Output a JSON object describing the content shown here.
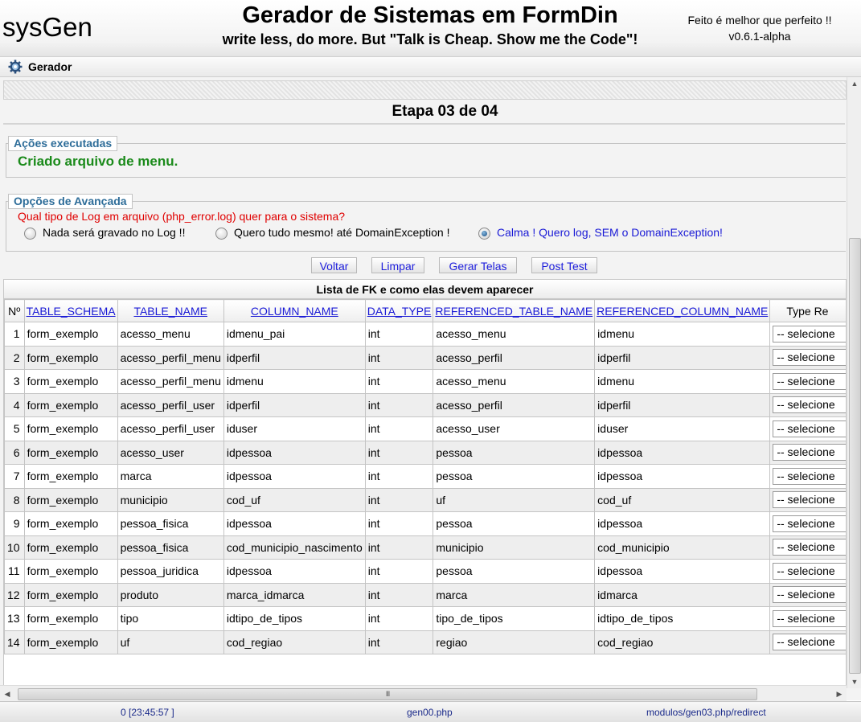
{
  "header": {
    "app_name": "sysGen",
    "title": "Gerador de Sistemas em FormDin",
    "subtitle": "write less, do more. But \"Talk is Cheap. Show me the Code\"!",
    "motto": "Feito é melhor que perfeito !!",
    "version": "v0.6.1-alpha"
  },
  "menu": {
    "icon": "gear-icon",
    "label": "Gerador"
  },
  "step": {
    "title": "Etapa 03 de 04"
  },
  "actions": {
    "legend": "Ações executadas",
    "message": "Criado arquivo de menu."
  },
  "options": {
    "legend": "Opções de Avançada",
    "question": "Qual tipo de Log em arquivo (php_error.log) quer para o sistema?",
    "radios": [
      {
        "label": "Nada será gravado no Log !!",
        "checked": false
      },
      {
        "label": "Quero tudo mesmo! até DomainException !",
        "checked": false
      },
      {
        "label": "Calma ! Quero log, SEM o DomainException!",
        "checked": true
      }
    ]
  },
  "buttons": {
    "back": "Voltar",
    "clear": "Limpar",
    "generate": "Gerar Telas",
    "post_test": "Post Test"
  },
  "grid": {
    "caption": "Lista de FK e como elas devem aparecer",
    "headers": [
      "Nº",
      "TABLE_SCHEMA",
      "TABLE_NAME",
      "COLUMN_NAME",
      "DATA_TYPE",
      "REFERENCED_TABLE_NAME",
      "REFERENCED_COLUMN_NAME",
      "Type Re"
    ],
    "select_placeholder": "-- selecione",
    "rows": [
      [
        "1",
        "form_exemplo",
        "acesso_menu",
        "idmenu_pai",
        "int",
        "acesso_menu",
        "idmenu"
      ],
      [
        "2",
        "form_exemplo",
        "acesso_perfil_menu",
        "idperfil",
        "int",
        "acesso_perfil",
        "idperfil"
      ],
      [
        "3",
        "form_exemplo",
        "acesso_perfil_menu",
        "idmenu",
        "int",
        "acesso_menu",
        "idmenu"
      ],
      [
        "4",
        "form_exemplo",
        "acesso_perfil_user",
        "idperfil",
        "int",
        "acesso_perfil",
        "idperfil"
      ],
      [
        "5",
        "form_exemplo",
        "acesso_perfil_user",
        "iduser",
        "int",
        "acesso_user",
        "iduser"
      ],
      [
        "6",
        "form_exemplo",
        "acesso_user",
        "idpessoa",
        "int",
        "pessoa",
        "idpessoa"
      ],
      [
        "7",
        "form_exemplo",
        "marca",
        "idpessoa",
        "int",
        "pessoa",
        "idpessoa"
      ],
      [
        "8",
        "form_exemplo",
        "municipio",
        "cod_uf",
        "int",
        "uf",
        "cod_uf"
      ],
      [
        "9",
        "form_exemplo",
        "pessoa_fisica",
        "idpessoa",
        "int",
        "pessoa",
        "idpessoa"
      ],
      [
        "10",
        "form_exemplo",
        "pessoa_fisica",
        "cod_municipio_nascimento",
        "int",
        "municipio",
        "cod_municipio"
      ],
      [
        "11",
        "form_exemplo",
        "pessoa_juridica",
        "idpessoa",
        "int",
        "pessoa",
        "idpessoa"
      ],
      [
        "12",
        "form_exemplo",
        "produto",
        "marca_idmarca",
        "int",
        "marca",
        "idmarca"
      ],
      [
        "13",
        "form_exemplo",
        "tipo",
        "idtipo_de_tipos",
        "int",
        "tipo_de_tipos",
        "idtipo_de_tipos"
      ],
      [
        "14",
        "form_exemplo",
        "uf",
        "cod_regiao",
        "int",
        "regiao",
        "cod_regiao"
      ]
    ]
  },
  "hscroll_grip": "III",
  "status": {
    "left": "0 [23:45:57 ]",
    "middle": "gen00.php",
    "right": "modulos/gen03.php/redirect"
  }
}
